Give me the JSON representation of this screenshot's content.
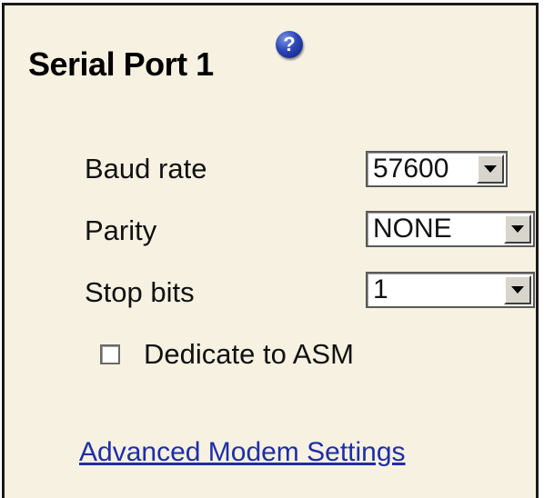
{
  "panel": {
    "title": "Serial Port 1",
    "help_icon": "?"
  },
  "fields": {
    "baud_rate": {
      "label": "Baud rate",
      "value": "57600"
    },
    "parity": {
      "label": "Parity",
      "value": "NONE"
    },
    "stop_bits": {
      "label": "Stop bits",
      "value": "1"
    }
  },
  "dedicate": {
    "label": "Dedicate to ASM",
    "checked": false
  },
  "links": {
    "advanced_modem": "Advanced Modem Settings"
  },
  "colors": {
    "panel_bg": "#f6f1e1",
    "link": "#1e2ea8",
    "help_icon": "#2d46b8"
  }
}
